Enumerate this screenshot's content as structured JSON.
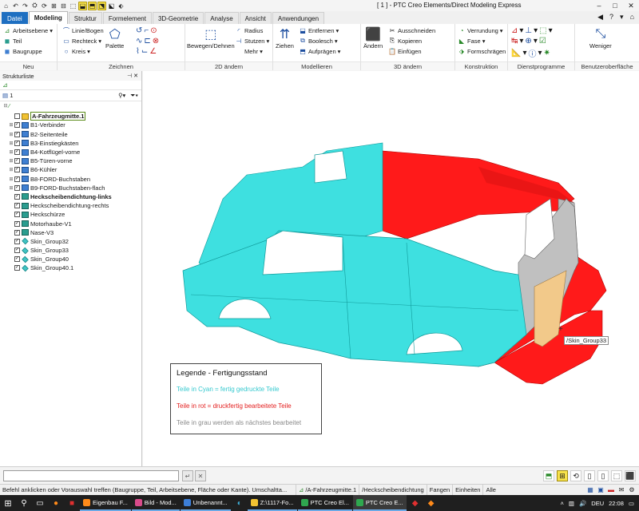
{
  "window": {
    "title": "[ 1 ] - PTC Creo Elements/Direct Modeling Express",
    "controls": [
      "–",
      "□",
      "✕"
    ]
  },
  "quick_access": [
    "⌂",
    "↶",
    "↷",
    "⛭",
    "⟳",
    "⊞",
    "⊟",
    "⬚",
    "⬓",
    "⬒",
    "⬔",
    "⬕",
    "⬖"
  ],
  "tabs": [
    {
      "label": "Datei"
    },
    {
      "label": "Modeling"
    },
    {
      "label": "Struktur"
    },
    {
      "label": "Formelement"
    },
    {
      "label": "3D-Geometrie"
    },
    {
      "label": "Analyse"
    },
    {
      "label": "Ansicht"
    },
    {
      "label": "Anwendungen"
    }
  ],
  "tab_right": [
    "◀",
    "?",
    "▾",
    "⌂"
  ],
  "ribbon": {
    "neu": {
      "label": "Neu",
      "items": [
        "Arbeitsebene",
        "Teil",
        "Baugruppe"
      ]
    },
    "zeichnen": {
      "label": "Zeichnen",
      "items": [
        "Linie/Bogen",
        "Rechteck",
        "Kreis",
        "Palette"
      ]
    },
    "zwei_d": {
      "label": "2D ändern",
      "items": [
        "Bewegen/Dehnen",
        "Radius",
        "Stutzen",
        "Mehr"
      ]
    },
    "modellieren": {
      "label": "Modellieren",
      "items": [
        "Ziehen",
        "Entfernen",
        "Boolesch",
        "Aufprägen"
      ]
    },
    "drei_d": {
      "label": "3D ändern",
      "items": [
        "Ändern",
        "Ausschneiden",
        "Kopieren",
        "Einfügen"
      ]
    },
    "konstruktion": {
      "label": "Konstruktion",
      "items": [
        "Verrundung",
        "Fase",
        "Formschrägen"
      ]
    },
    "dienst": {
      "label": "Dienstprogramme"
    },
    "benutzer": {
      "label": "Benutzeroberfläche",
      "items": [
        "Weniger"
      ]
    }
  },
  "panel": {
    "title": "Strukturliste",
    "counter": "1",
    "tree": [
      {
        "label": "A-Fahrzeugmitte.1",
        "icon": "workplane",
        "checked": false,
        "expand": "",
        "style": "boxed"
      },
      {
        "label": "B1-Verbinder",
        "icon": "assembly",
        "checked": true,
        "expand": "⊞"
      },
      {
        "label": "B2-Seitenteile",
        "icon": "assembly",
        "checked": true,
        "expand": "⊞"
      },
      {
        "label": "B3-Einstiegkästen",
        "icon": "assembly",
        "checked": true,
        "expand": "⊞"
      },
      {
        "label": "B4-Kotflügel-vorne",
        "icon": "assembly",
        "checked": true,
        "expand": "⊞"
      },
      {
        "label": "B5-Türen-vorne",
        "icon": "assembly",
        "checked": true,
        "expand": "⊞"
      },
      {
        "label": "B6-Kühler",
        "icon": "assembly",
        "checked": true,
        "expand": "⊞"
      },
      {
        "label": "B8-FORD-Buchstaben",
        "icon": "assembly",
        "checked": true,
        "expand": "⊞"
      },
      {
        "label": "B9-FORD-Buchstaben-flach",
        "icon": "assembly",
        "checked": true,
        "expand": "⊞"
      },
      {
        "label": "Heckscheibendichtung-links",
        "icon": "part",
        "checked": true,
        "expand": "",
        "style": "bold"
      },
      {
        "label": "Heckscheibendichtung-rechts",
        "icon": "part",
        "checked": true,
        "expand": ""
      },
      {
        "label": "Heckschürze",
        "icon": "part",
        "checked": true,
        "expand": ""
      },
      {
        "label": "Motorhaube-V1",
        "icon": "part",
        "checked": true,
        "expand": ""
      },
      {
        "label": "Nase-V3",
        "icon": "part",
        "checked": true,
        "expand": ""
      },
      {
        "label": "Skin_Group32",
        "icon": "skin",
        "checked": true,
        "expand": ""
      },
      {
        "label": "Skin_Group33",
        "icon": "skin",
        "checked": true,
        "expand": ""
      },
      {
        "label": "Skin_Group40",
        "icon": "skin",
        "checked": true,
        "expand": ""
      },
      {
        "label": "Skin_Group40.1",
        "icon": "skin",
        "checked": true,
        "expand": ""
      }
    ]
  },
  "legend": {
    "title": "Legende - Fertigungsstand",
    "cyan": "Teile in Cyan = fertig gedruckte Teile",
    "red": "Teile in rot = druckfertig bearbeitete Teile",
    "grey": "Teile in grau werden als nächstes bearbeitet"
  },
  "tooltip": "/Skin_Group33",
  "colors": {
    "cyan": "#3ee0e0",
    "red": "#ff1a1a",
    "grey": "#b8b8b8",
    "tan": "#f2c98a",
    "accent": "#1e6fc1"
  },
  "status": {
    "message": "Befehl anklicken oder Vorauswahl treffen (Baugruppe, Teil, Arbeitsebene, Fläche oder Kante). Umschaltta...",
    "workplane": "/A-Fahrzeugmitte.1",
    "part": "/Heckscheibendichtung",
    "catch": "Fangen",
    "units": "Einheiten",
    "filter": "Alle"
  },
  "taskbar": {
    "items": [
      {
        "label": "Eigenbau F..."
      },
      {
        "label": "Bild - Mod..."
      },
      {
        "label": "Unbenannt..."
      },
      {
        "label": "Z:\\1117-Fo..."
      },
      {
        "label": "PTC Creo El..."
      },
      {
        "label": "PTC Creo E..."
      }
    ],
    "lang": "DEU",
    "time": "22:08"
  }
}
